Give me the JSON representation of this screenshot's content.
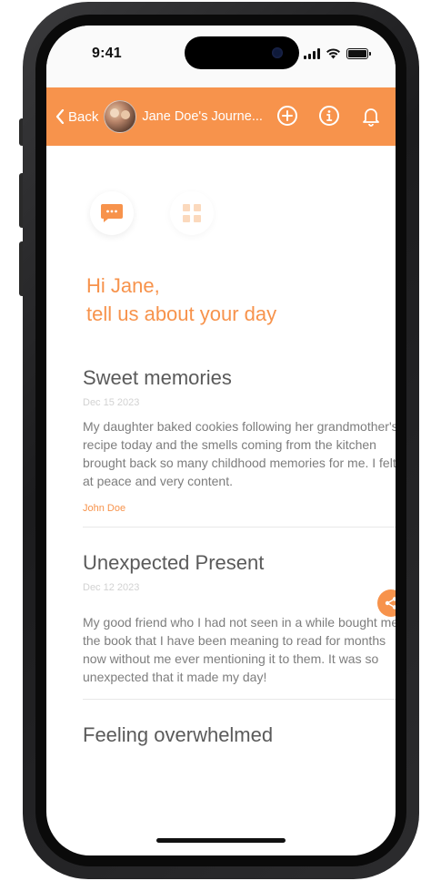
{
  "status_bar": {
    "time": "9:41"
  },
  "nav": {
    "back_label": "Back",
    "title": "Jane Doe's Journe...",
    "icons": [
      "add-circle-icon",
      "info-icon",
      "bell-icon"
    ]
  },
  "view_toggle": {
    "active": "chat",
    "options": [
      "chat-view",
      "grid-view"
    ]
  },
  "greeting": {
    "line1": "Hi Jane,",
    "line2": "tell us about your day"
  },
  "entries": [
    {
      "title": "Sweet memories",
      "date": "Dec 15 2023",
      "body": "My daughter baked cookies following her grandmother's recipe today and the smells coming from the kitchen brought back so many childhood memories for me. I felt at peace and very content.",
      "author": "John Doe"
    },
    {
      "title": "Unexpected Present",
      "date": "Dec 12 2023",
      "body": "My good friend who I had not seen in a while bought me the book that I have been meaning to read for months now without me ever mentioning it to them. It was so unexpected that it made my day!"
    },
    {
      "title": "Feeling overwhelmed"
    }
  ],
  "colors": {
    "accent": "#f7934c",
    "title_text": "#5a5a5a",
    "body_text": "#7d7d7d",
    "date_text": "#d2d2d2"
  }
}
